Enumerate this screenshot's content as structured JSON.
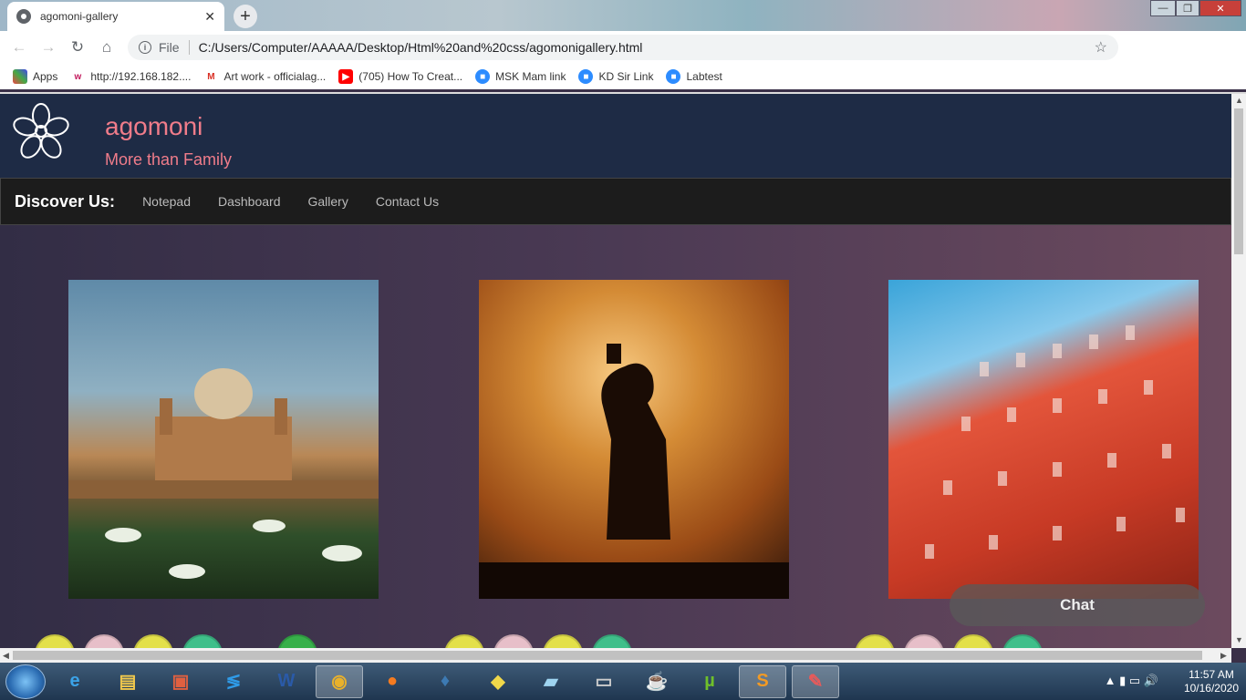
{
  "browser": {
    "tab_title": "agomoni-gallery",
    "new_tab": "+",
    "tab_close": "✕",
    "address_prefix": "File",
    "address_url": "C:/Users/Computer/AAAAA/Desktop/Html%20and%20css/agomonigallery.html",
    "bookmarks": [
      {
        "label": "Apps",
        "icon": "apps-grid-icon",
        "color": "#e44"
      },
      {
        "label": "http://192.168.182....",
        "icon": "w-logo-icon",
        "color": "#c2185b"
      },
      {
        "label": "Art work - officialag...",
        "icon": "gmail-icon",
        "color": "#d93025"
      },
      {
        "label": "(705) How To Creat...",
        "icon": "youtube-icon",
        "color": "#ff0000"
      },
      {
        "label": "MSK Mam link",
        "icon": "zoom-icon",
        "color": "#2d8cff"
      },
      {
        "label": "KD Sir Link",
        "icon": "zoom-icon",
        "color": "#2d8cff"
      },
      {
        "label": "Labtest",
        "icon": "zoom-icon",
        "color": "#2d8cff"
      }
    ]
  },
  "site": {
    "brand": "agomoni",
    "tagline": "More than Family",
    "nav_title": "Discover Us:",
    "nav_links": [
      "Notepad",
      "Dashboard",
      "Gallery",
      "Contact Us"
    ],
    "gallery": [
      {
        "name": "tomb-photo",
        "description": ""
      },
      {
        "name": "aarti-photo",
        "description": ""
      },
      {
        "name": "hawa-mahal-photo",
        "description": ""
      }
    ],
    "chat_label": "Chat",
    "colors": {
      "brand": "#f07c8a",
      "header_bg": "#1e2b45",
      "nav_bg": "#1c1c1c"
    }
  },
  "taskbar": {
    "time": "11:57 AM",
    "date": "10/16/2020"
  }
}
